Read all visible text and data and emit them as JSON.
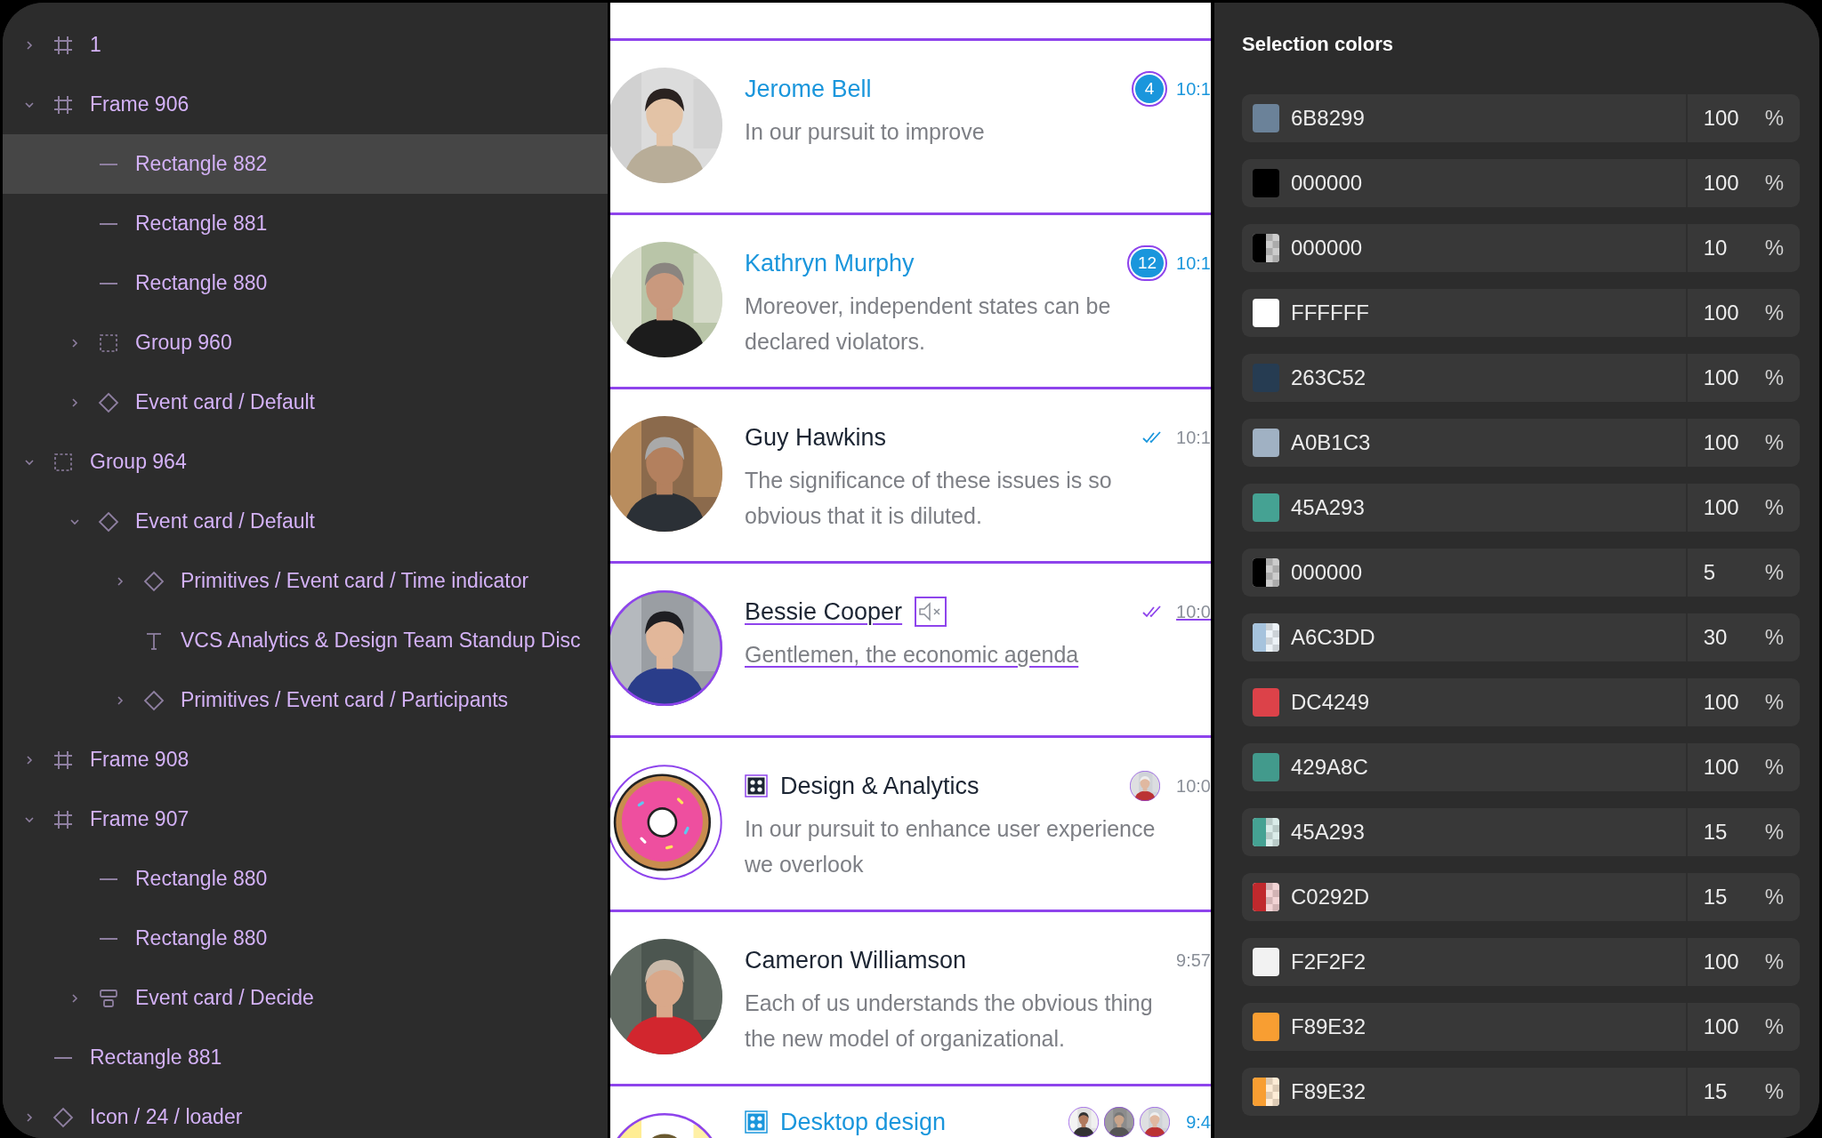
{
  "layers": [
    {
      "kind": "frame",
      "label": "1",
      "expanded": false
    },
    {
      "kind": "frame",
      "label": "Frame 906",
      "expanded": true,
      "children": [
        {
          "kind": "rect",
          "label": "Rectangle 882",
          "selected": true
        },
        {
          "kind": "rect",
          "label": "Rectangle 881",
          "selected": false
        },
        {
          "kind": "rect",
          "label": "Rectangle 880",
          "selected": false
        },
        {
          "kind": "group",
          "label": "Group 960",
          "expanded": false
        },
        {
          "kind": "component",
          "label": "Event card / Default",
          "expanded": false
        }
      ]
    },
    {
      "kind": "group",
      "label": "Group 964",
      "expanded": true,
      "children": [
        {
          "kind": "component",
          "label": "Event card / Default",
          "expanded": true,
          "children": [
            {
              "kind": "component",
              "label": "Primitives / Event card / Time indicator",
              "expanded": false
            },
            {
              "kind": "text",
              "label": "VCS Analytics & Design Team Standup Disc",
              "selected": false
            },
            {
              "kind": "component",
              "label": "Primitives / Event card / Participants",
              "expanded": false
            }
          ]
        }
      ]
    },
    {
      "kind": "frame",
      "label": "Frame 908",
      "expanded": false
    },
    {
      "kind": "frame",
      "label": "Frame 907",
      "expanded": true,
      "children": [
        {
          "kind": "rect",
          "label": "Rectangle 880",
          "selected": false
        },
        {
          "kind": "rect",
          "label": "Rectangle 880",
          "selected": false
        },
        {
          "kind": "autolayout",
          "label": "Event card / Decide",
          "expanded": false
        }
      ]
    },
    {
      "kind": "rect",
      "label": "Rectangle 881",
      "selected": false
    },
    {
      "kind": "component",
      "label": "Icon / 24 / loader",
      "expanded": false
    }
  ],
  "chats": [
    {
      "name": "Jerome Bell",
      "unread": true,
      "badge": "4",
      "time": "10:1",
      "message": [
        "In our pursuit to improve"
      ]
    },
    {
      "name": "Kathryn Murphy",
      "unread": true,
      "badge": "12",
      "time": "10:1",
      "message": [
        "Moreover, independent states can be",
        "declared violators."
      ]
    },
    {
      "name": "Guy Hawkins",
      "unread": false,
      "read": true,
      "time": "10:1",
      "message": [
        "The significance of these issues is so",
        "obvious that it is diluted."
      ]
    },
    {
      "name": "Bessie Cooper",
      "unread": false,
      "read": true,
      "muted": true,
      "time": "10:0",
      "message": [
        "Gentlemen, the economic agenda"
      ]
    },
    {
      "name": "Design & Analytics",
      "unread": false,
      "group": true,
      "participants": [
        {
          "kind": "picture"
        }
      ],
      "time": "10:0",
      "message": [
        "In our pursuit to enhance user experience",
        "we overlook"
      ]
    },
    {
      "name": "Cameron Williamson",
      "unread": false,
      "time": "9:57",
      "message": [
        "Each of us understands the obvious thing",
        "the new model of organizational."
      ]
    },
    {
      "name": "Desktop design",
      "unread": true,
      "group": true,
      "participants": [
        {
          "kind": "picture"
        },
        {
          "kind": "picture"
        },
        {
          "kind": "picture"
        }
      ],
      "time": "9:4"
    }
  ],
  "selection_colors": {
    "title": "Selection colors",
    "items": [
      {
        "hex": "6B8299",
        "color": "#6b8299",
        "opacity": "100",
        "unit": "%",
        "translucent": false
      },
      {
        "hex": "000000",
        "color": "#000000",
        "opacity": "100",
        "unit": "%",
        "translucent": false
      },
      {
        "hex": "000000",
        "color": "#000000",
        "opacity": "10",
        "unit": "%",
        "translucent": true
      },
      {
        "hex": "FFFFFF",
        "color": "#ffffff",
        "opacity": "100",
        "unit": "%",
        "translucent": false
      },
      {
        "hex": "263C52",
        "color": "#263c52",
        "opacity": "100",
        "unit": "%",
        "translucent": false
      },
      {
        "hex": "A0B1C3",
        "color": "#a0b1c3",
        "opacity": "100",
        "unit": "%",
        "translucent": false
      },
      {
        "hex": "45A293",
        "color": "#45a293",
        "opacity": "100",
        "unit": "%",
        "translucent": false
      },
      {
        "hex": "000000",
        "color": "#000000",
        "opacity": "5",
        "unit": "%",
        "translucent": true
      },
      {
        "hex": "A6C3DD",
        "color": "#a6c3dd",
        "opacity": "30",
        "unit": "%",
        "translucent": true
      },
      {
        "hex": "DC4249",
        "color": "#dc4249",
        "opacity": "100",
        "unit": "%",
        "translucent": false
      },
      {
        "hex": "429A8C",
        "color": "#429a8c",
        "opacity": "100",
        "unit": "%",
        "translucent": false
      },
      {
        "hex": "45A293",
        "color": "#45a293",
        "opacity": "15",
        "unit": "%",
        "translucent": true
      },
      {
        "hex": "C0292D",
        "color": "#c0292d",
        "opacity": "15",
        "unit": "%",
        "translucent": true
      },
      {
        "hex": "F2F2F2",
        "color": "#f2f2f2",
        "opacity": "100",
        "unit": "%",
        "translucent": false
      },
      {
        "hex": "F89E32",
        "color": "#f89e32",
        "opacity": "100",
        "unit": "%",
        "translucent": false
      },
      {
        "hex": "F89E32",
        "color": "#f89e32",
        "opacity": "15",
        "unit": "%",
        "translucent": true
      }
    ]
  }
}
